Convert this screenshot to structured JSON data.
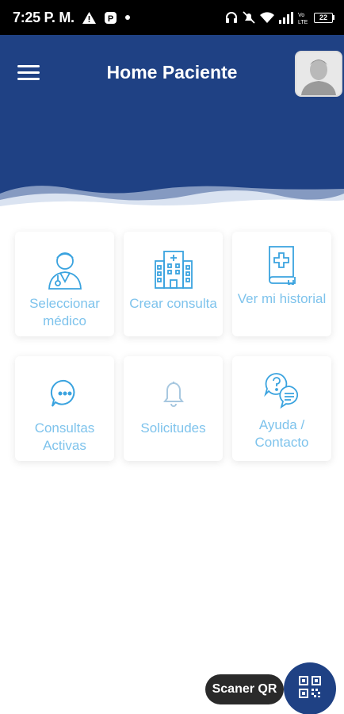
{
  "status_bar": {
    "time": "7:25 P. M.",
    "icons": [
      "warning-icon",
      "app-notification-icon",
      "dot-icon",
      "headphones-icon",
      "mute-icon",
      "wifi-icon",
      "signal-icon",
      "volte-icon",
      "battery-icon"
    ],
    "battery_level": "22"
  },
  "header": {
    "title": "Home Paciente",
    "menu_icon": "hamburger-menu-icon",
    "avatar_icon": "user-avatar",
    "background_color": "#1f4184"
  },
  "cards": [
    {
      "label": "Seleccionar médico",
      "icon": "doctor-icon"
    },
    {
      "label": "Crear consulta",
      "icon": "hospital-building-icon"
    },
    {
      "label": "Ver mi historial",
      "icon": "medical-record-icon"
    },
    {
      "label": "Consultas Activas",
      "icon": "chat-bubble-icon"
    },
    {
      "label": "Solicitudes",
      "icon": "bell-icon"
    },
    {
      "label": "Ayuda / Contacto",
      "icon": "help-chat-icon"
    }
  ],
  "card_label_color": "#7ec3ec",
  "fab": {
    "label": "Scaner QR",
    "icon": "qr-code-icon"
  }
}
